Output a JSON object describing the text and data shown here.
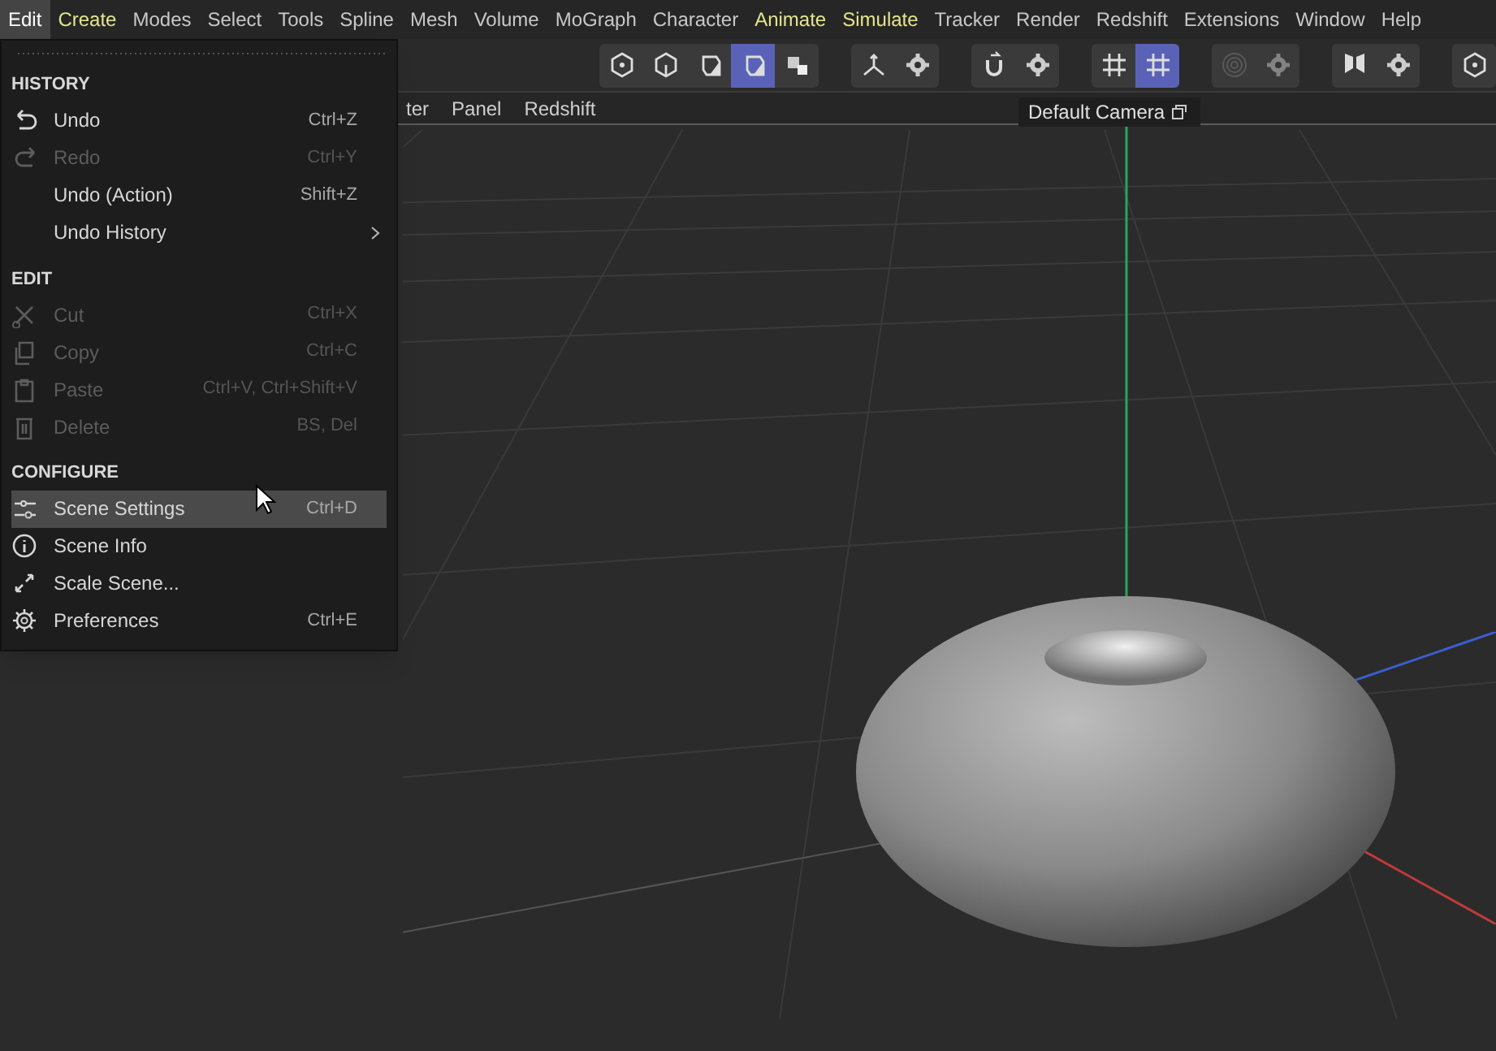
{
  "menubar": [
    {
      "label": "Edit",
      "selected": true,
      "kind": "plain"
    },
    {
      "label": "Create",
      "selected": false,
      "kind": "accent"
    },
    {
      "label": "Modes",
      "selected": false,
      "kind": "plain"
    },
    {
      "label": "Select",
      "selected": false,
      "kind": "plain"
    },
    {
      "label": "Tools",
      "selected": false,
      "kind": "plain"
    },
    {
      "label": "Spline",
      "selected": false,
      "kind": "plain"
    },
    {
      "label": "Mesh",
      "selected": false,
      "kind": "plain"
    },
    {
      "label": "Volume",
      "selected": false,
      "kind": "plain"
    },
    {
      "label": "MoGraph",
      "selected": false,
      "kind": "plain"
    },
    {
      "label": "Character",
      "selected": false,
      "kind": "plain"
    },
    {
      "label": "Animate",
      "selected": false,
      "kind": "accent"
    },
    {
      "label": "Simulate",
      "selected": false,
      "kind": "accent"
    },
    {
      "label": "Tracker",
      "selected": false,
      "kind": "plain"
    },
    {
      "label": "Render",
      "selected": false,
      "kind": "plain"
    },
    {
      "label": "Redshift",
      "selected": false,
      "kind": "plain"
    },
    {
      "label": "Extensions",
      "selected": false,
      "kind": "plain"
    },
    {
      "label": "Window",
      "selected": false,
      "kind": "plain"
    },
    {
      "label": "Help",
      "selected": false,
      "kind": "plain"
    }
  ],
  "toolbar": [
    [
      {
        "kind": "hex",
        "selected": false,
        "disabled": false
      },
      {
        "kind": "cube-open",
        "selected": false,
        "disabled": false
      },
      {
        "kind": "cube",
        "selected": false,
        "disabled": false
      },
      {
        "kind": "cube",
        "selected": true,
        "disabled": false
      },
      {
        "kind": "cubes",
        "selected": false,
        "disabled": false
      }
    ],
    [
      {
        "kind": "axis",
        "selected": false,
        "disabled": false
      },
      {
        "kind": "gear",
        "selected": false,
        "disabled": false
      }
    ],
    [
      {
        "kind": "magnet",
        "selected": false,
        "disabled": false
      },
      {
        "kind": "gear",
        "selected": false,
        "disabled": false
      }
    ],
    [
      {
        "kind": "grid",
        "selected": false,
        "disabled": false
      },
      {
        "kind": "grid",
        "selected": true,
        "disabled": false
      }
    ],
    [
      {
        "kind": "rings",
        "selected": false,
        "disabled": true
      },
      {
        "kind": "gear",
        "selected": false,
        "disabled": true
      }
    ],
    [
      {
        "kind": "butterfly",
        "selected": false,
        "disabled": false
      },
      {
        "kind": "gear",
        "selected": false,
        "disabled": false
      }
    ],
    [
      {
        "kind": "hex",
        "selected": false,
        "disabled": false
      }
    ]
  ],
  "viewport_menu": [
    "ter",
    "Panel",
    "Redshift"
  ],
  "camera": {
    "label": "Default Camera"
  },
  "dropdown": {
    "sections": [
      {
        "title": "HISTORY",
        "items": [
          {
            "kind": "undo",
            "label": "Undo",
            "shortcut": "Ctrl+Z",
            "disabled": false,
            "selected": false,
            "submenu": false
          },
          {
            "kind": "redo",
            "label": "Redo",
            "shortcut": "Ctrl+Y",
            "disabled": true,
            "selected": false,
            "submenu": false
          },
          {
            "kind": "none",
            "label": "Undo (Action)",
            "shortcut": "Shift+Z",
            "disabled": false,
            "selected": false,
            "submenu": false
          },
          {
            "kind": "none",
            "label": "Undo History",
            "disabled": false,
            "selected": false,
            "submenu": true
          }
        ]
      },
      {
        "title": "EDIT",
        "items": [
          {
            "kind": "cut",
            "label": "Cut",
            "shortcut": "Ctrl+X",
            "disabled": true,
            "selected": false,
            "submenu": false
          },
          {
            "kind": "copy",
            "label": "Copy",
            "shortcut": "Ctrl+C",
            "disabled": true,
            "selected": false,
            "submenu": false
          },
          {
            "kind": "paste",
            "label": "Paste",
            "shortcut": "Ctrl+V, Ctrl+Shift+V",
            "disabled": true,
            "selected": false,
            "submenu": false
          },
          {
            "kind": "delete",
            "label": "Delete",
            "shortcut": "BS, Del",
            "disabled": true,
            "selected": false,
            "submenu": false
          }
        ]
      },
      {
        "title": "CONFIGURE",
        "items": [
          {
            "kind": "sliders",
            "label": "Scene Settings",
            "shortcut": "Ctrl+D",
            "disabled": false,
            "selected": true,
            "submenu": false
          },
          {
            "kind": "info",
            "label": "Scene Info",
            "disabled": false,
            "selected": false,
            "submenu": false
          },
          {
            "kind": "scale",
            "label": "Scale Scene...",
            "disabled": false,
            "selected": false,
            "submenu": false
          },
          {
            "kind": "gear",
            "label": "Preferences",
            "shortcut": "Ctrl+E",
            "disabled": false,
            "selected": false,
            "submenu": false
          }
        ]
      }
    ]
  }
}
